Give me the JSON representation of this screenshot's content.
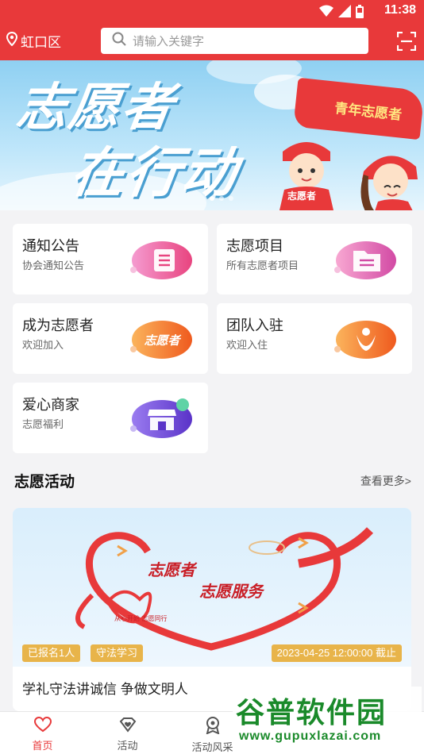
{
  "status": {
    "time": "11:38"
  },
  "header": {
    "location": "虹口区",
    "search_placeholder": "请输入关键字"
  },
  "banner": {
    "line1": "志愿者",
    "line2": "在行动",
    "flag_text": "青年志愿者",
    "vest_text": "志愿者"
  },
  "grid": [
    {
      "title": "通知公告",
      "subtitle": "协会通知公告",
      "icon": "notice-icon",
      "color": "#e84f9a"
    },
    {
      "title": "志愿项目",
      "subtitle": "所有志愿者项目",
      "icon": "folder-icon",
      "color": "#e25aa8"
    },
    {
      "title": "成为志愿者",
      "subtitle": "欢迎加入",
      "icon": "volunteer-badge-icon",
      "color": "#f0701e",
      "art_text": "志愿者"
    },
    {
      "title": "团队入驻",
      "subtitle": "欢迎入住",
      "icon": "team-icon",
      "color": "#f0701e"
    },
    {
      "title": "爱心商家",
      "subtitle": "志愿福利",
      "icon": "store-icon",
      "color": "#6f4bd8"
    }
  ],
  "section": {
    "title": "志愿活动",
    "more": "查看更多>"
  },
  "activity": {
    "image_text_1": "志愿者",
    "image_text_2": "志愿服务",
    "image_text_3": "从心开始 志愿同行",
    "badges": [
      "已报名1人",
      "守法学习"
    ],
    "deadline": "2023-04-25 12:00:00 截止",
    "title": "学礼守法讲诚信 争做文明人"
  },
  "bottom_nav": [
    {
      "label": "首页",
      "icon": "heart-icon",
      "active": true
    },
    {
      "label": "活动",
      "icon": "diamond-heart-icon",
      "active": false
    },
    {
      "label": "活动风采",
      "icon": "medal-icon",
      "active": false
    }
  ],
  "watermark": {
    "logo": "谷普软件园",
    "url": "www.gupuxlazai.com"
  },
  "colors": {
    "brand": "#e8393a",
    "badge": "#e8b44a",
    "watermark": "#1a8a2a"
  }
}
